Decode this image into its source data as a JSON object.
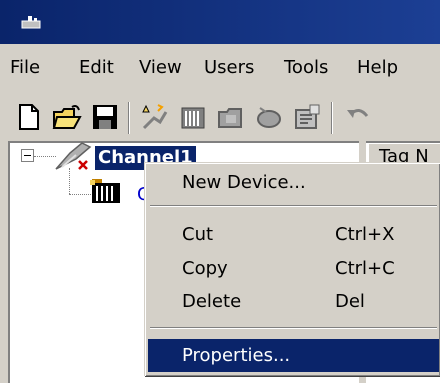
{
  "menubar": {
    "items": [
      "File",
      "Edit",
      "View",
      "Users",
      "Tools",
      "Help"
    ]
  },
  "tree": {
    "channel_label": "Channel1",
    "device_label_partial": "C"
  },
  "right_pane": {
    "column_header": "Tag N"
  },
  "context_menu": {
    "new_device": "New Device...",
    "cut": "Cut",
    "cut_shortcut": "Ctrl+X",
    "copy": "Copy",
    "copy_shortcut": "Ctrl+C",
    "delete": "Delete",
    "delete_shortcut": "Del",
    "properties": "Properties..."
  },
  "colors": {
    "titlebar": "#0a246a",
    "selection": "#0a246a",
    "face": "#d4d0c8"
  },
  "icons": {
    "toolbar": [
      "new-file-icon",
      "open-folder-icon",
      "save-disk-icon",
      "new-channel-icon",
      "new-device-icon",
      "new-group-icon",
      "new-tag-icon",
      "properties-icon",
      "undo-icon"
    ]
  }
}
